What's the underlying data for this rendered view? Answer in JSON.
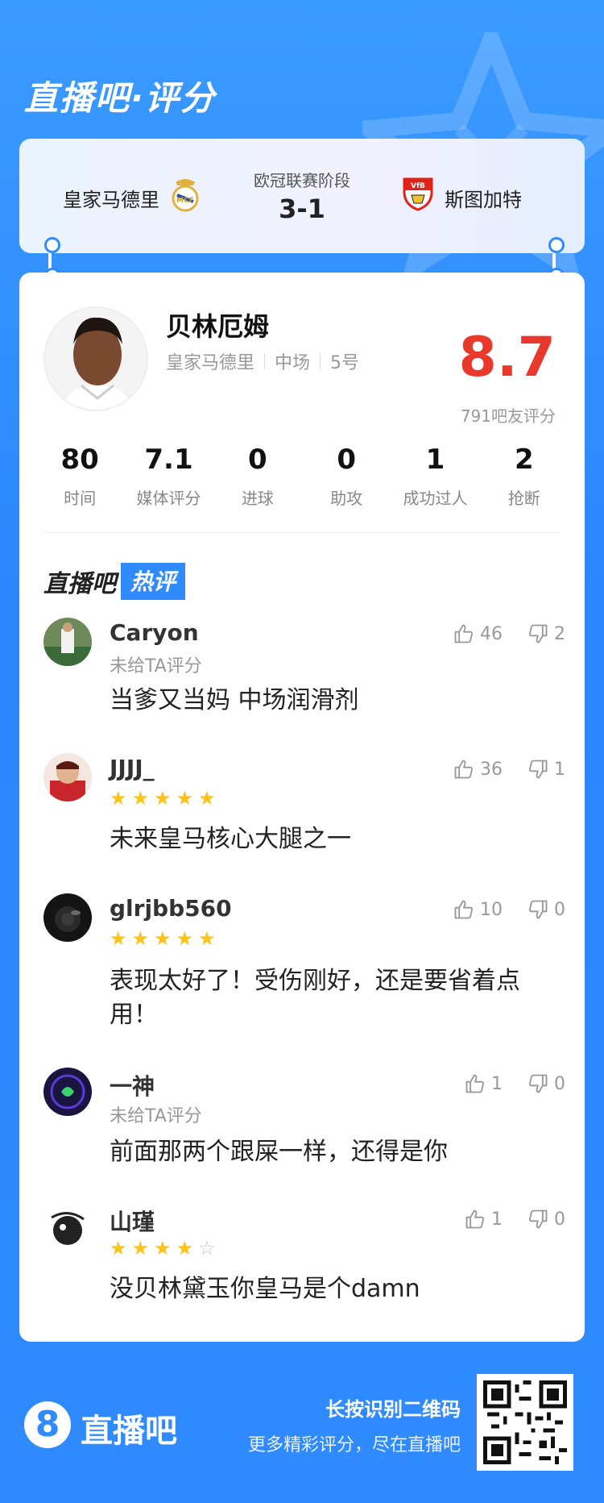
{
  "header": {
    "title": "直播吧·评分"
  },
  "match": {
    "home_team": "皇家马德里",
    "away_team": "斯图加特",
    "stage": "欧冠联赛阶段",
    "score": "3-1"
  },
  "player": {
    "name": "贝林厄姆",
    "team": "皇家马德里",
    "position": "中场",
    "number": "5号",
    "rating": "8.7",
    "rating_count": "791吧友评分"
  },
  "stats": [
    {
      "value": "80",
      "label": "时间"
    },
    {
      "value": "7.1",
      "label": "媒体评分"
    },
    {
      "value": "0",
      "label": "进球"
    },
    {
      "value": "0",
      "label": "助攻"
    },
    {
      "value": "1",
      "label": "成功过人"
    },
    {
      "value": "2",
      "label": "抢断"
    }
  ],
  "hot_section": {
    "prefix": "直播吧",
    "tag": "热评"
  },
  "comments": [
    {
      "user": "Caryon",
      "subtitle": "未给TA评分",
      "stars": 0,
      "text": "当爹又当妈 中场润滑剂",
      "likes": "46",
      "dislikes": "2"
    },
    {
      "user": "JJJJ_",
      "subtitle": "",
      "stars": 5,
      "text": "未来皇马核心大腿之一",
      "likes": "36",
      "dislikes": "1"
    },
    {
      "user": "glrjbb560",
      "subtitle": "",
      "stars": 5,
      "text": "表现太好了！受伤刚好，还是要省着点用！",
      "likes": "10",
      "dislikes": "0"
    },
    {
      "user": "一神",
      "subtitle": "未给TA评分",
      "stars": 0,
      "text": "前面那两个跟屎一样，还得是你",
      "likes": "1",
      "dislikes": "0"
    },
    {
      "user": "山瑾",
      "subtitle": "",
      "stars": 4,
      "text": "没贝林黛玉你皇马是个damn",
      "likes": "1",
      "dislikes": "0"
    }
  ],
  "footer": {
    "logo_mark": "8",
    "logo_text": "直播吧",
    "line1": "长按识别二维码",
    "line2": "更多精彩评分，尽在直播吧"
  },
  "colors": {
    "brand_blue": "#2f8bff",
    "rating_red": "#e8392c",
    "star_gold": "#ffc21a"
  }
}
